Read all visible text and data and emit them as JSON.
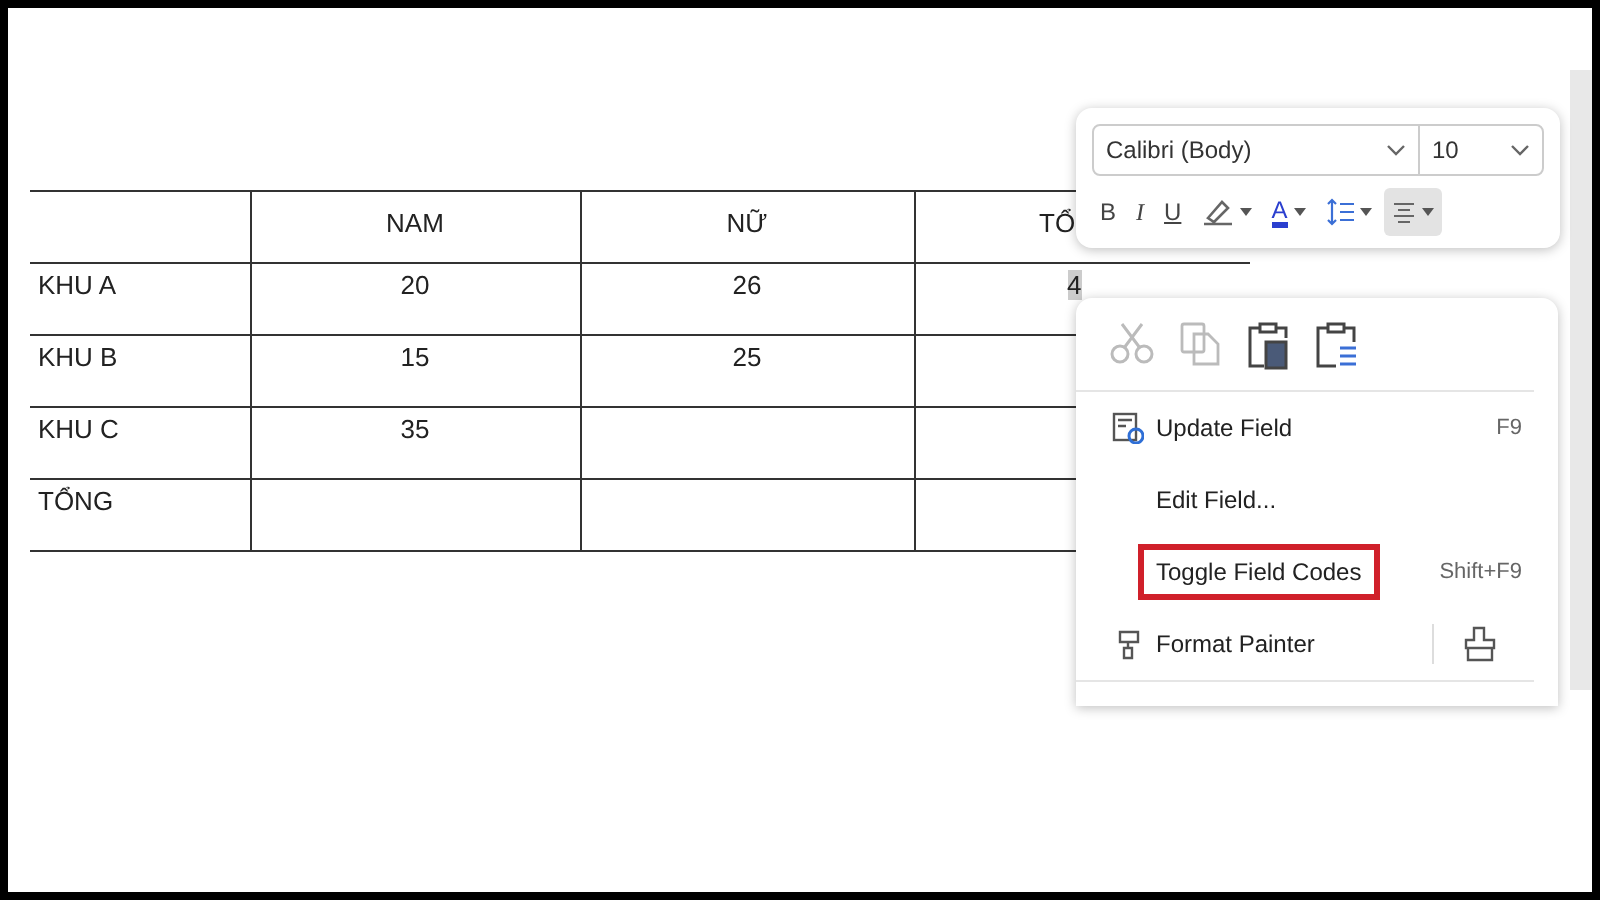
{
  "table": {
    "columns": [
      null,
      "NAM",
      "NỮ",
      "TỔ"
    ],
    "rows": [
      {
        "cells": [
          "KHU A",
          "20",
          "26",
          "4"
        ],
        "selected": true
      },
      {
        "cells": [
          "KHU B",
          "15",
          "25"
        ],
        "selected": false
      },
      {
        "cells": [
          "KHU C",
          "35"
        ],
        "selected": false
      },
      {
        "cells": [
          "TỔNG"
        ],
        "selected": false
      }
    ]
  },
  "toolbar": {
    "font": "Calibri (Body)",
    "size": "10",
    "buttons": [
      {
        "kind": "bold",
        "label": "B",
        "dropdown": false,
        "selected": false
      },
      {
        "kind": "italic",
        "label": "I",
        "dropdown": false,
        "selected": false
      },
      {
        "kind": "underline",
        "label": "U",
        "dropdown": false,
        "selected": false
      },
      {
        "kind": "highlight",
        "dropdown": true,
        "selected": false
      },
      {
        "kind": "font-color",
        "label": "A",
        "dropdown": true,
        "selected": false
      },
      {
        "kind": "line-spacing",
        "dropdown": true,
        "selected": false
      },
      {
        "kind": "align",
        "dropdown": true,
        "selected": true
      }
    ]
  },
  "context_menu": {
    "clipboard": [
      {
        "kind": "cut",
        "disabled": true
      },
      {
        "kind": "copy",
        "disabled": true
      },
      {
        "kind": "paste",
        "disabled": false
      },
      {
        "kind": "paste-text",
        "disabled": false
      }
    ],
    "items": [
      {
        "kind": "update",
        "label": "Update Field",
        "shortcut": "F9",
        "highlighted": false
      },
      {
        "kind": "plain",
        "label": "Edit Field...",
        "highlighted": false
      },
      {
        "kind": "plain",
        "label": "Toggle Field Codes",
        "shortcut": "Shift+F9",
        "highlighted": true
      },
      {
        "kind": "painter",
        "label": "Format Painter",
        "highlighted": false
      }
    ]
  }
}
